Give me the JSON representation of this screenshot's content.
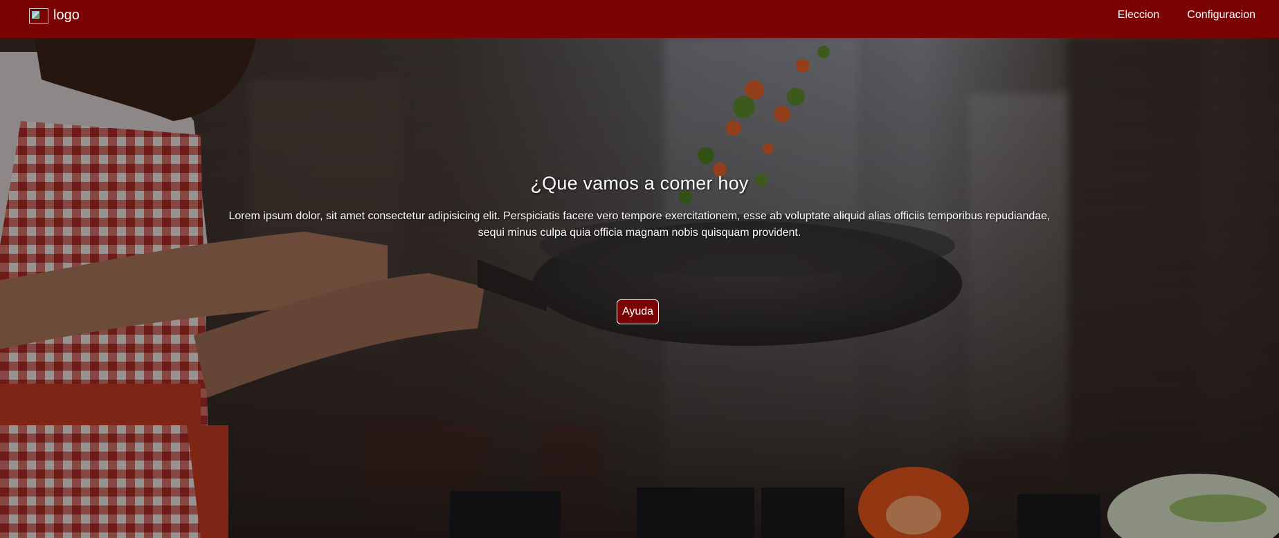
{
  "header": {
    "logo_text": "logo",
    "nav": [
      {
        "label": "Eleccion"
      },
      {
        "label": "Configuracion"
      }
    ]
  },
  "hero": {
    "title": "¿Que vamos a comer hoy",
    "text": "Lorem ipsum dolor, sit amet consectetur adipisicing elit. Perspiciatis facere vero tempore exercitationem, esse ab voluptate aliquid alias officiis temporibus repudiandae, sequi minus culpa quia officia magnam nobis quisquam provident.",
    "button_label": "Ayuda"
  },
  "colors": {
    "brand": "#7a0404",
    "text": "#ffffff"
  },
  "icons": {
    "logo": "broken-image-icon"
  }
}
